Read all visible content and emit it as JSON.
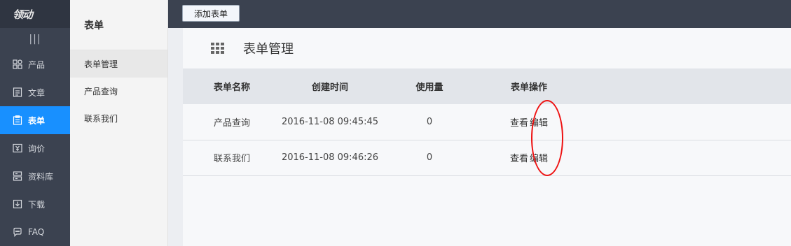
{
  "logo": {
    "text": "领动"
  },
  "nav": {
    "items": [
      {
        "label": "产品",
        "icon": "grid-icon"
      },
      {
        "label": "文章",
        "icon": "article-icon"
      },
      {
        "label": "表单",
        "icon": "form-icon",
        "active": true
      },
      {
        "label": "询价",
        "icon": "inquiry-icon"
      },
      {
        "label": "资料库",
        "icon": "database-icon"
      },
      {
        "label": "下载",
        "icon": "download-icon"
      },
      {
        "label": "FAQ",
        "icon": "faq-icon"
      }
    ]
  },
  "subnav": {
    "title": "表单",
    "items": [
      {
        "label": "表单管理",
        "active": true
      },
      {
        "label": "产品查询"
      },
      {
        "label": "联系我们"
      }
    ]
  },
  "toolbar": {
    "add_label": "添加表单"
  },
  "page": {
    "title": "表单管理"
  },
  "table": {
    "headers": [
      "表单名称",
      "创建时间",
      "使用量",
      "表单操作"
    ],
    "rows": [
      {
        "name": "产品查询",
        "created": "2016-11-08 09:45:45",
        "usage": "0",
        "view": "查看",
        "edit": "编辑"
      },
      {
        "name": "联系我们",
        "created": "2016-11-08 09:46:26",
        "usage": "0",
        "view": "查看",
        "edit": "编辑"
      }
    ]
  },
  "colors": {
    "sidebar": "#3b4250",
    "active": "#1890ff",
    "annotation": "#ee1111"
  }
}
